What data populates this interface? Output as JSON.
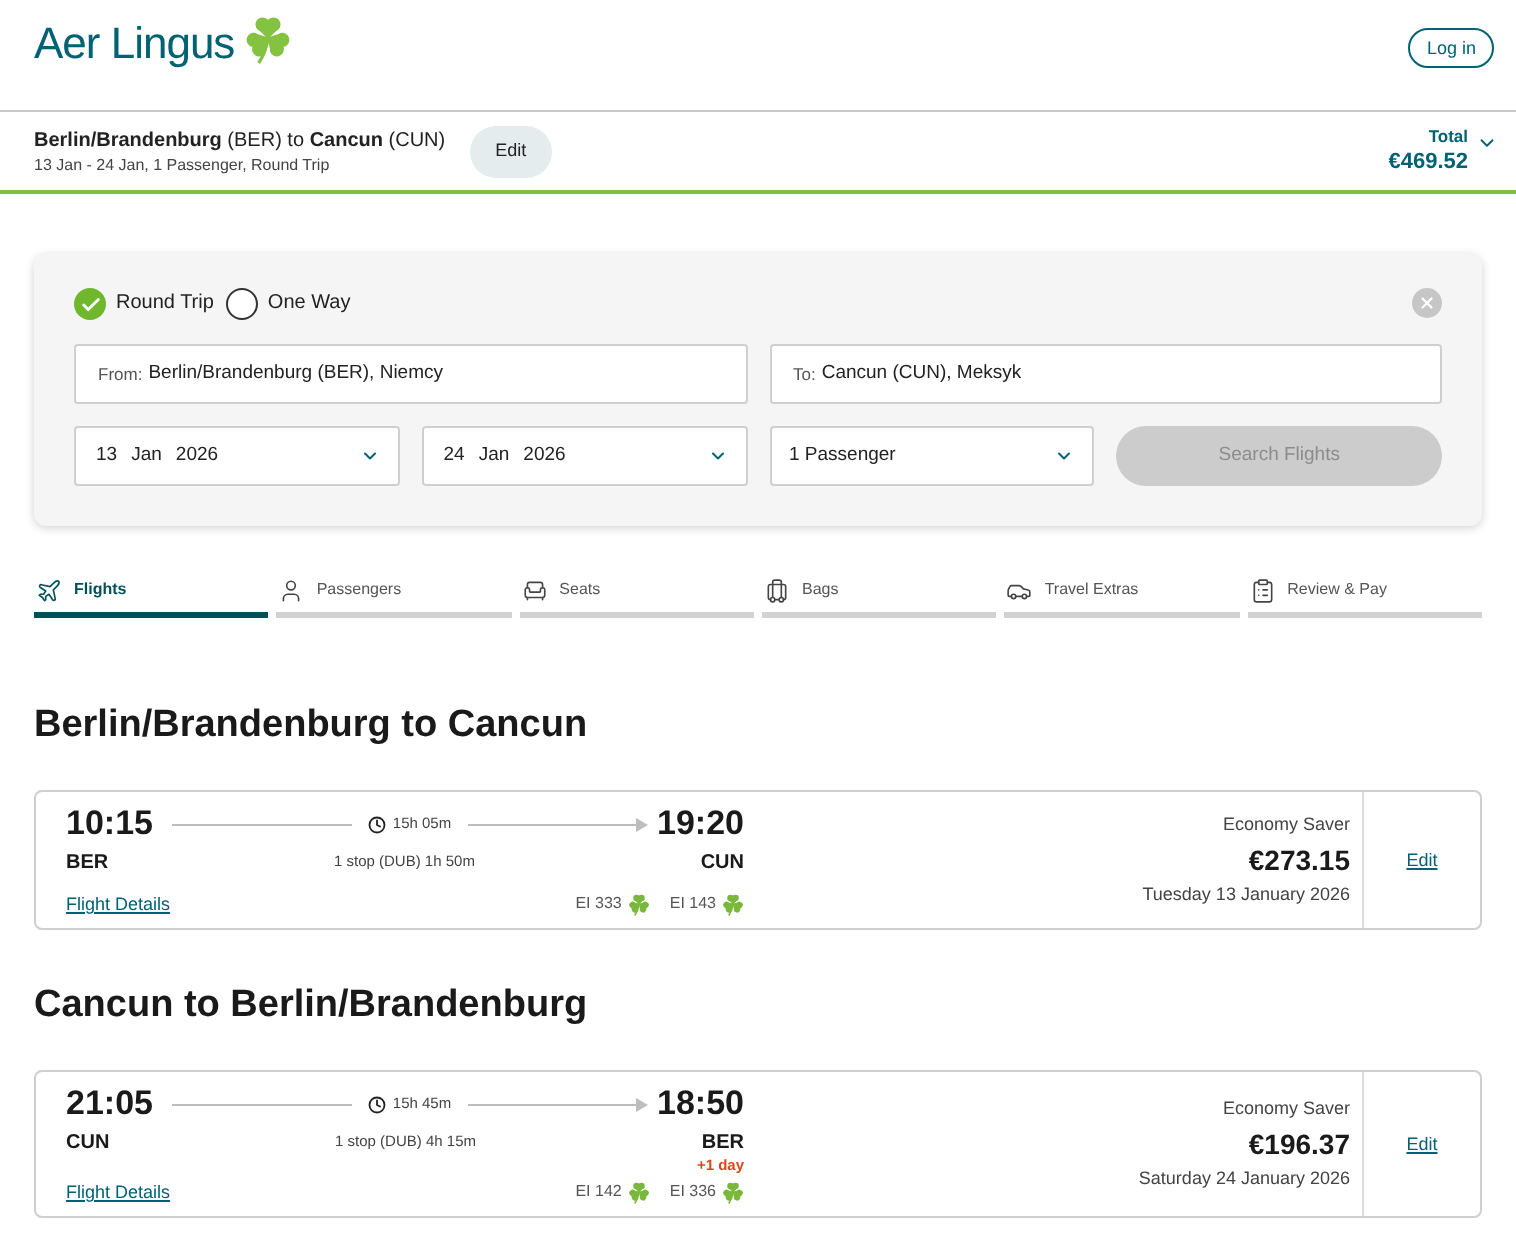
{
  "header": {
    "logo_text": "Aer Lingus",
    "login_button": "Log in"
  },
  "trip_summary": {
    "route": "**Berlin/Brandenburg** (BER) to **Cancun** (CUN)",
    "details": "13 Jan - 24 Jan, 1 Passenger, Round Trip",
    "edit_button": "Edit",
    "total_label": "Total",
    "total": "€469.52"
  },
  "search": {
    "trip_types": [
      {
        "label": "Round Trip",
        "selected": true
      },
      {
        "label": "One Way",
        "selected": false
      }
    ],
    "from": {
      "label": "From:",
      "value": "Berlin/Brandenburg (BER), Niemcy"
    },
    "to": {
      "label": "To:",
      "value": "Cancun (CUN), Meksyk"
    },
    "dates": [
      {
        "day": "13",
        "month": "Jan",
        "year": "2026"
      },
      {
        "day": "24",
        "month": "Jan",
        "year": "2026"
      }
    ],
    "passengers": "1 Passenger",
    "search_button": {
      "label": "Search Flights",
      "disabled": true
    }
  },
  "steps": [
    {
      "label": "Flights",
      "selected": true
    },
    {
      "label": "Passengers",
      "selected": false
    },
    {
      "label": "Seats",
      "selected": false
    },
    {
      "label": "Bags",
      "selected": false
    },
    {
      "label": "Travel Extras",
      "selected": false
    },
    {
      "label": "Review & Pay",
      "selected": false
    }
  ],
  "journeys": [
    {
      "heading": "Berlin/Brandenburg to Cancun",
      "depart_time": "10:15",
      "depart_code": "BER",
      "duration": "15h 05m",
      "stops": "1 stop (DUB) 1h 50m",
      "arrive_time": "19:20",
      "arrive_code": "CUN",
      "details_link": "Flight Details",
      "flights": [
        "EI 333",
        "EI 143"
      ],
      "fare": "Economy Saver",
      "price": "€273.15",
      "date": "Tuesday 13 January 2026",
      "edit_link": "Edit"
    },
    {
      "heading": "Cancun to Berlin/Brandenburg",
      "depart_time": "21:05",
      "depart_code": "CUN",
      "duration": "15h 45m",
      "stops": "1 stop (DUB) 4h 15m",
      "arrive_time": "18:50",
      "arrive_code": "BER",
      "day_offset": "+1 day",
      "details_link": "Flight Details",
      "flights": [
        "EI 142",
        "EI 336"
      ],
      "fare": "Economy Saver",
      "price": "€196.37",
      "date": "Saturday 24 January 2026",
      "edit_link": "Edit"
    }
  ]
}
